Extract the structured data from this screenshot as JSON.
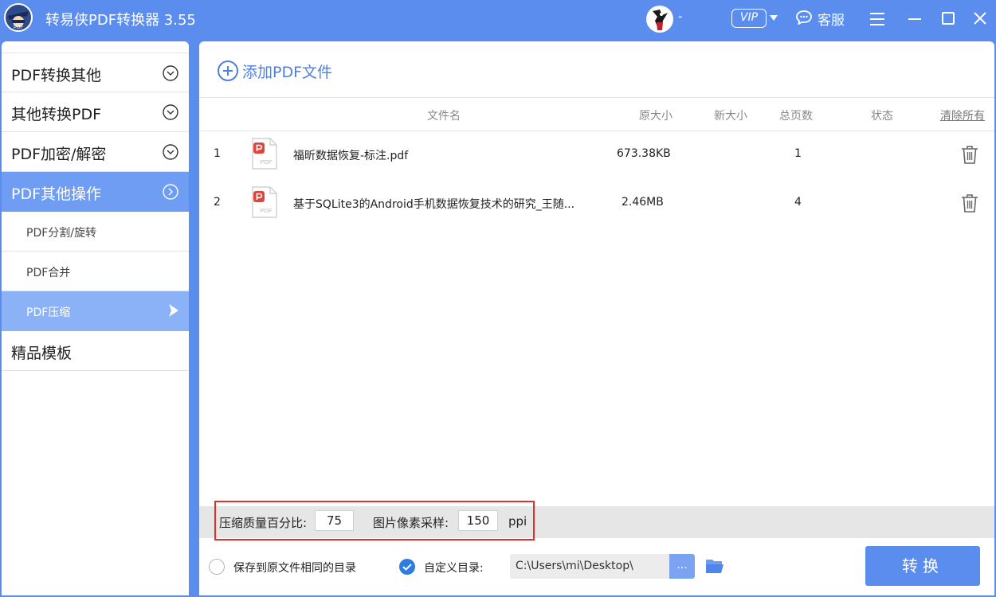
{
  "titlebar": {
    "app_title": "转易侠PDF转换器 3.55",
    "user_name": "-",
    "vip_label": "VIP",
    "service_label": "客服"
  },
  "sidebar": {
    "categories": [
      {
        "label": "PDF转换其他"
      },
      {
        "label": "其他转换PDF"
      },
      {
        "label": "PDF加密/解密"
      },
      {
        "label": "PDF其他操作"
      }
    ],
    "sub_items": [
      {
        "label": "PDF分割/旋转"
      },
      {
        "label": "PDF合并"
      },
      {
        "label": "PDF压缩"
      }
    ],
    "templates": {
      "label": "精品模板"
    }
  },
  "main": {
    "add_label": "添加PDF文件",
    "columns": {
      "filename": "文件名",
      "orig_size": "原大小",
      "new_size": "新大小",
      "pages": "总页数",
      "status": "状态",
      "clear_all": "清除所有"
    },
    "rows": [
      {
        "index": "1",
        "icon_text": "PDF",
        "filename": "福昕数据恢复-标注.pdf",
        "orig_size": "673.38KB",
        "new_size": "",
        "pages": "1",
        "status": ""
      },
      {
        "index": "2",
        "icon_text": "PDF",
        "filename": "基于SQLite3的Android手机数据恢复技术的研究_王随...",
        "orig_size": "2.46MB",
        "new_size": "",
        "pages": "4",
        "status": ""
      }
    ]
  },
  "settings": {
    "quality_label": "压缩质量百分比:",
    "quality_value": "75",
    "ppi_label": "图片像素采样:",
    "ppi_value": "150",
    "ppi_unit": "ppi"
  },
  "output": {
    "same_dir_label": "保存到原文件相同的目录",
    "custom_dir_label": "自定义目录:",
    "path": "C:\\Users\\mi\\Desktop\\",
    "browse_label": "...",
    "convert_label": "转换"
  },
  "colors": {
    "accent": "#5b8def",
    "active_category": "#6e9df3",
    "active_sub": "#8bb1f6",
    "highlight_border": "#e0302a",
    "pdf_red": "#e0443f"
  },
  "icons": {
    "logo": "app-logo-icon",
    "avatar": "user-avatar",
    "service": "chat-bubble-icon",
    "menu": "hamburger-icon",
    "minimize": "minimize-icon",
    "maximize": "maximize-icon",
    "close": "close-icon",
    "add": "plus-circle-icon",
    "file": "pdf-file-icon",
    "delete": "trash-icon",
    "folder": "folder-icon",
    "checked": "check-circle-icon"
  }
}
